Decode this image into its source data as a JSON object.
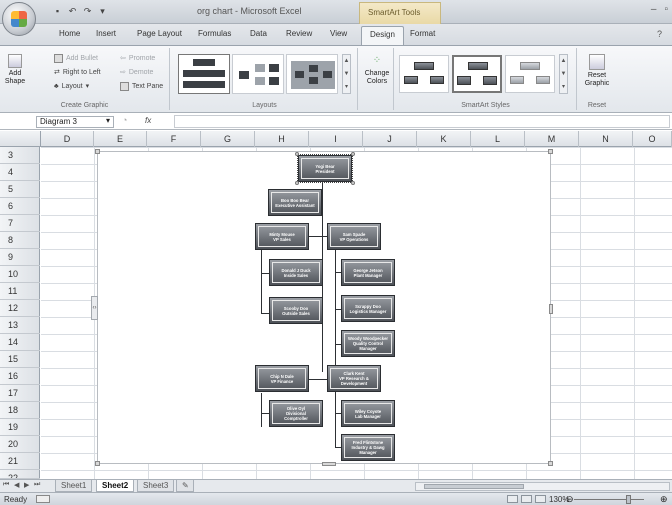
{
  "window": {
    "title": "org chart - Microsoft Excel",
    "contextual_group": "SmartArt Tools"
  },
  "tabs": [
    "Home",
    "Insert",
    "Page Layout",
    "Formulas",
    "Data",
    "Review",
    "View",
    "Design",
    "Format"
  ],
  "active_tab": "Design",
  "ribbon": {
    "create_graphic": {
      "label": "Create Graphic",
      "add_shape": "Add\nShape",
      "add_bullet": "Add Bullet",
      "right_to_left": "Right to Left",
      "layout": "Layout",
      "promote": "Promote",
      "demote": "Demote",
      "text_pane": "Text Pane"
    },
    "layouts_label": "Layouts",
    "change_colors": "Change\nColors",
    "smartart_styles_label": "SmartArt Styles",
    "reset": {
      "label": "Reset",
      "button": "Reset\nGraphic"
    }
  },
  "formula_bar": {
    "name_box": "Diagram 3",
    "fx": "fx",
    "formula": ""
  },
  "columns": [
    "D",
    "E",
    "F",
    "G",
    "H",
    "I",
    "J",
    "K",
    "L",
    "M",
    "N",
    "O"
  ],
  "rows": [
    "3",
    "4",
    "5",
    "6",
    "7",
    "8",
    "9",
    "10",
    "11",
    "12",
    "13",
    "14",
    "15",
    "16",
    "17",
    "18",
    "19",
    "20",
    "21",
    "22"
  ],
  "org_chart": {
    "nodes": [
      {
        "id": "yogi",
        "text": "Yogi Bear\nPresident",
        "selected": true
      },
      {
        "id": "boo",
        "text": "Boo Boo Bear\nExecutive Assistant"
      },
      {
        "id": "minty",
        "text": "Minty Mouse\nVP Sales"
      },
      {
        "id": "sam",
        "text": "Sam Spade\nVP Operations"
      },
      {
        "id": "donald",
        "text": "Donald J Duck\nInside Sales"
      },
      {
        "id": "george",
        "text": "George Jetson\nPlant Manager"
      },
      {
        "id": "scooby",
        "text": "Scooby Doo\nOutside Sales"
      },
      {
        "id": "scrappy",
        "text": "Scrappy Doo\nLogistics Manager"
      },
      {
        "id": "woody",
        "text": "Woody Woodpecker\nQuality Control\nManager"
      },
      {
        "id": "chip",
        "text": "Chip N Dale\nVP Finance"
      },
      {
        "id": "clark",
        "text": "Clark Kent\nVP Research &\nDevelopment"
      },
      {
        "id": "olive",
        "text": "Olive Oyl\nDivisional\nComptroller"
      },
      {
        "id": "wiley",
        "text": "Wiley Coyote\nLab Manager"
      },
      {
        "id": "fred",
        "text": "Fred Flintstone\nIndustry & Dawg\nManager"
      }
    ]
  },
  "sheets": [
    "Sheet1",
    "Sheet2",
    "Sheet3"
  ],
  "active_sheet": "Sheet2",
  "status": {
    "ready": "Ready",
    "zoom": "130%"
  }
}
